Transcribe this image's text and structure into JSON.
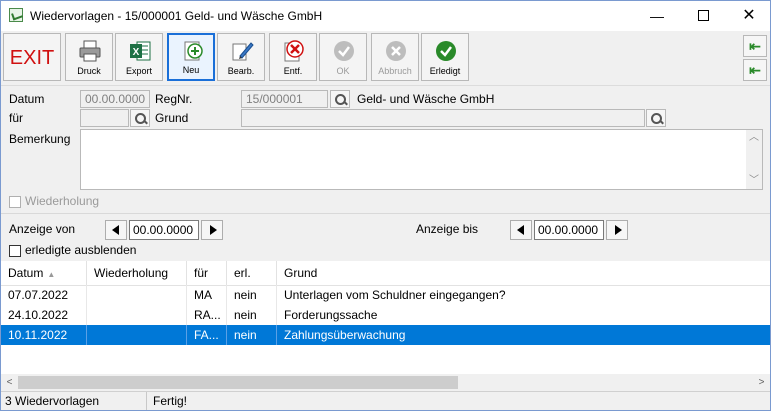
{
  "window": {
    "title": "Wiedervorlagen - 15/000001 Geld- und Wäsche GmbH",
    "min": "—",
    "close": "✕"
  },
  "toolbar": {
    "exit_label": "EXIT",
    "druck": "Druck",
    "export": "Export",
    "neu": "Neu",
    "bearb": "Bearb.",
    "entf": "Entf.",
    "ok": "OK",
    "abbruch": "Abbruch",
    "erledigt": "Erledigt",
    "nav_first": "⇤",
    "nav_prev": "⇤"
  },
  "form": {
    "datum_label": "Datum",
    "datum_value": "00.00.0000",
    "regnr_label": "RegNr.",
    "regnr_value": "15/000001",
    "company": "Geld- und Wäsche GmbH",
    "fuer_label": "für",
    "fuer_value": "",
    "grund_label": "Grund",
    "grund_value": "",
    "bemerkung_label": "Bemerkung",
    "bemerkung_value": "",
    "wiederholung_label": "Wiederholung"
  },
  "filter": {
    "anzeige_von_label": "Anzeige von",
    "anzeige_von_value": "00.00.0000",
    "anzeige_bis_label": "Anzeige bis",
    "anzeige_bis_value": "00.00.0000",
    "erledigte_label": "erledigte ausblenden"
  },
  "grid": {
    "columns": [
      "Datum",
      "Wiederholung",
      "für",
      "erl.",
      "Grund"
    ],
    "sort_indicator": "▲",
    "rows": [
      {
        "datum": "07.07.2022",
        "wiederholung": "",
        "fuer": "MA",
        "erl": "nein",
        "grund": "Unterlagen vom Schuldner eingegangen?"
      },
      {
        "datum": "24.10.2022",
        "wiederholung": "",
        "fuer": "RA...",
        "erl": "nein",
        "grund": "Forderungssache"
      },
      {
        "datum": "10.11.2022",
        "wiederholung": "",
        "fuer": "FA...",
        "erl": "nein",
        "grund": "Zahlungsüberwachung"
      }
    ]
  },
  "status": {
    "count": "3 Wiedervorlagen",
    "message": "Fertig!"
  },
  "colors": {
    "accent": "#0078d7",
    "exit": "#d01010",
    "green": "#2a8a2a"
  }
}
